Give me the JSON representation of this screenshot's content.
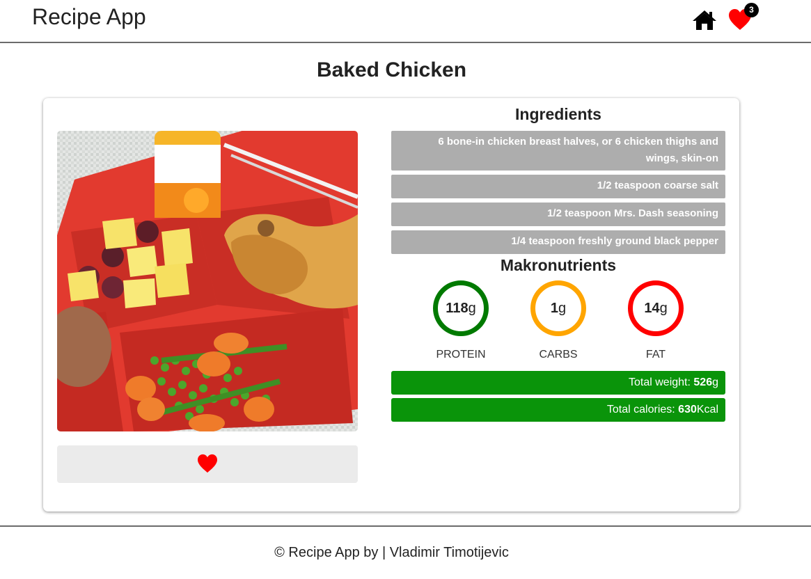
{
  "app": {
    "brand": "Recipe App"
  },
  "nav": {
    "favorites_count": "3",
    "home_icon": "home-icon",
    "favorites_icon": "heart-icon"
  },
  "recipe": {
    "title": "Baked Chicken",
    "image_icon": "food-photo",
    "ingredients_title": "Ingredients",
    "ingredients": [
      "6 bone-in chicken breast halves, or 6 chicken thighs and wings, skin-on",
      "1/2 teaspoon coarse salt",
      "1/2 teaspoon Mrs. Dash seasoning",
      "1/4 teaspoon freshly ground black pepper"
    ],
    "macros_title": "Makronutrients",
    "macros": [
      {
        "value": "118",
        "unit": "g",
        "label": "PROTEIN",
        "color": "#007a00"
      },
      {
        "value": "1",
        "unit": "g",
        "label": "CARBS",
        "color": "#ffa500"
      },
      {
        "value": "14",
        "unit": "g",
        "label": "FAT",
        "color": "#ff0000"
      }
    ],
    "total_weight": {
      "label": "Total weight: ",
      "value": "526",
      "unit": "g"
    },
    "total_calories": {
      "label": "Total calories: ",
      "value": "630",
      "unit": "Kcal"
    },
    "favorite_icon": "heart-icon"
  },
  "colors": {
    "accent_green": "#0a940a",
    "heart_red": "#ff0000",
    "ingredient_bg": "#adadad"
  },
  "footer": {
    "text": "© Recipe App by | Vladimir Timotijevic"
  }
}
